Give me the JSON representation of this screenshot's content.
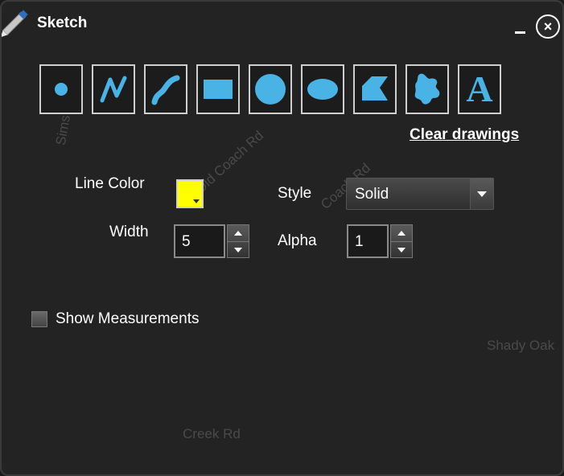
{
  "window": {
    "title": "Sketch"
  },
  "icons": {
    "pencil": "pencil-icon",
    "minimize": "minimize-icon",
    "close": "close-icon"
  },
  "accent_color": "#4ab3e6",
  "tools": [
    {
      "name": "point-tool",
      "icon": "point-icon"
    },
    {
      "name": "polyline-tool",
      "icon": "polyline-icon"
    },
    {
      "name": "freehand-tool",
      "icon": "freehand-icon"
    },
    {
      "name": "rectangle-tool",
      "icon": "rectangle-icon"
    },
    {
      "name": "circle-tool",
      "icon": "circle-icon"
    },
    {
      "name": "ellipse-tool",
      "icon": "ellipse-icon"
    },
    {
      "name": "polygon-tool",
      "icon": "polygon-icon"
    },
    {
      "name": "freehand-polygon-tool",
      "icon": "freehand-polygon-icon"
    },
    {
      "name": "text-tool",
      "icon": "text-icon",
      "glyph": "A"
    }
  ],
  "clear_label": "Clear drawings",
  "line_color": {
    "label": "Line Color",
    "value": "#ffff00"
  },
  "style": {
    "label": "Style",
    "value": "Solid"
  },
  "width": {
    "label": "Width",
    "value": "5"
  },
  "alpha": {
    "label": "Alpha",
    "value": "1"
  },
  "show_measurements": {
    "label": "Show Measurements",
    "checked": false
  },
  "map_labels": [
    "Old Coach Rd",
    "Coach Rd",
    "Shady Oak",
    "Creek Rd",
    "Sims"
  ]
}
